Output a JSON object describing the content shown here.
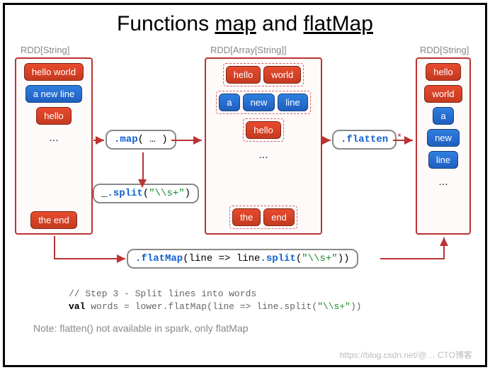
{
  "title_parts": {
    "prefix": "Functions ",
    "map": "map",
    "and": " and ",
    "flatmap": "flatMap"
  },
  "labels": {
    "rdd_string_left": "RDD[String]",
    "rdd_array_mid": "RDD[Array[String]]",
    "rdd_string_right": "RDD[String]"
  },
  "col_left": {
    "items": [
      {
        "text": "hello world",
        "cls": "red"
      },
      {
        "text": "a new line",
        "cls": "blue"
      },
      {
        "text": "hello",
        "cls": "red"
      }
    ],
    "tail": {
      "text": "the end",
      "cls": "red"
    }
  },
  "col_mid": {
    "groups": [
      [
        {
          "text": "hello",
          "cls": "red"
        },
        {
          "text": "world",
          "cls": "red"
        }
      ],
      [
        {
          "text": "a",
          "cls": "blue"
        },
        {
          "text": "new",
          "cls": "blue"
        },
        {
          "text": "line",
          "cls": "blue"
        }
      ],
      [
        {
          "text": "hello",
          "cls": "red"
        }
      ]
    ],
    "tail_group": [
      {
        "text": "the",
        "cls": "red"
      },
      {
        "text": "end",
        "cls": "red"
      }
    ]
  },
  "col_right": {
    "items": [
      {
        "text": "hello",
        "cls": "red"
      },
      {
        "text": "world",
        "cls": "red"
      },
      {
        "text": "a",
        "cls": "blue"
      },
      {
        "text": "new",
        "cls": "blue"
      },
      {
        "text": "line",
        "cls": "blue"
      }
    ]
  },
  "dots": "...",
  "code": {
    "map_box": {
      "kw": ".map",
      "open": "( ",
      "arg": "…",
      "close": " )"
    },
    "split_box": {
      "prefix": "_",
      "kw": ".split",
      "open": "(",
      "str": "\"\\\\s+\"",
      "close": ")"
    },
    "flatten_box": {
      "kw": ".flatten"
    },
    "flatmap_box": {
      "kw": ".flatMap",
      "open": "(line => line",
      "kw2": ".split",
      "open2": "(",
      "str": "\"\\\\s+\"",
      "close": "))"
    }
  },
  "footer": {
    "comment": "// Step 3 - Split lines into words",
    "line2_prefix": "val ",
    "line2_var": "words",
    "line2_eq": "  = lower",
    "line2_kw": ".flatMap",
    "line2_open": "(line => line",
    "line2_kw2": ".split",
    "line2_open2": "(",
    "line2_str": "\"\\\\s+\"",
    "line2_close": "))"
  },
  "note": "Note: flatten() not available in spark, only flatMap",
  "watermark": "https://blog.csdn.net/@… CTO博客"
}
